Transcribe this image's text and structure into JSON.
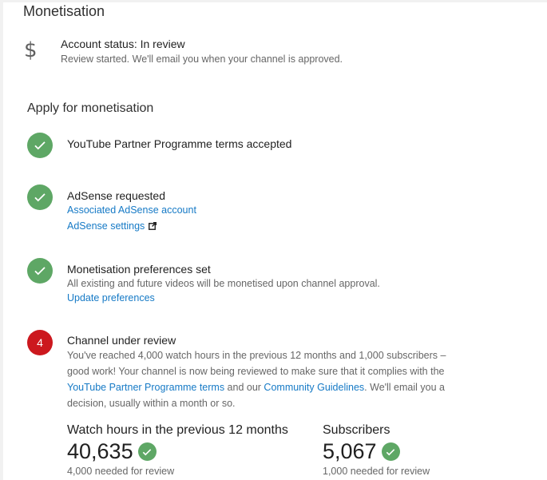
{
  "page": {
    "title": "Monetisation"
  },
  "account_status": {
    "icon": "dollar-icon",
    "status_text": "Account status: In review",
    "description": "Review started. We'll email you when your channel is approved."
  },
  "apply": {
    "heading": "Apply for monetisation",
    "steps": [
      {
        "title": "YouTube Partner Programme terms accepted",
        "state": "done"
      },
      {
        "title": "AdSense requested",
        "state": "done",
        "links": [
          "Associated AdSense account",
          "AdSense settings"
        ]
      },
      {
        "title": "Monetisation preferences set",
        "state": "done",
        "description": "All existing and future videos will be monetised upon channel approval.",
        "links": [
          "Update preferences"
        ]
      },
      {
        "number": "4",
        "title": "Channel under review",
        "state": "in-progress",
        "description_parts": {
          "p1": "You've reached 4,000 watch hours in the previous 12 months and 1,000 subscribers – good work! Your channel is now being reviewed to make sure that it complies with the ",
          "link1": "YouTube Partner Programme terms",
          "p2": " and our ",
          "link2": "Community Guidelines",
          "p3": ". We'll email you a decision, usually within a month or so."
        }
      }
    ]
  },
  "metrics": {
    "watch_hours": {
      "label": "Watch hours in the previous 12 months",
      "value": "40,635",
      "requirement": "4,000 needed for review"
    },
    "subscribers": {
      "label": "Subscribers",
      "value": "5,067",
      "requirement": "1,000 needed for review"
    }
  },
  "colors": {
    "success_green": "#5ea765",
    "alert_red": "#cc181e",
    "link_blue": "#167ac6"
  }
}
